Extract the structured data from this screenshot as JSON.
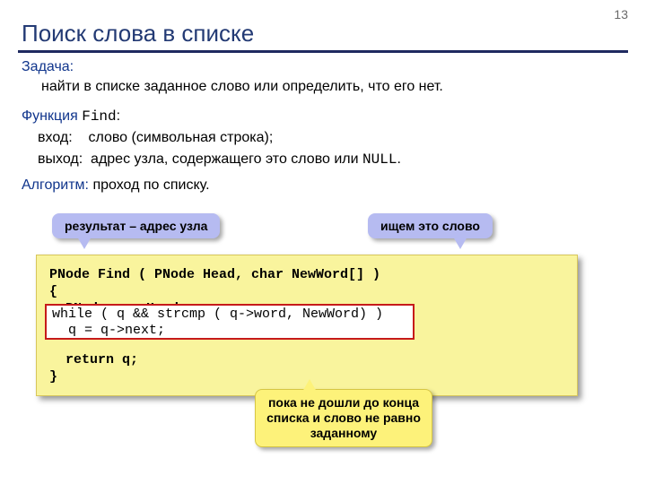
{
  "page_number": "13",
  "title": "Поиск слова в списке",
  "task": {
    "label": "Задача:",
    "text": "найти в списке заданное слово или определить, что его нет."
  },
  "func": {
    "label": "Функция",
    "name": "Find",
    "colon": ":",
    "in_label": "вход:",
    "in_text": "слово (символьная строка);",
    "out_label": "выход:",
    "out_text1": "адрес узла, содержащего это слово или",
    "out_null": "NULL",
    "out_dot": "."
  },
  "algo": {
    "label": "Алгоритм:",
    "text": "проход по списку."
  },
  "callouts": {
    "result": "результат – адрес узла",
    "search": "ищем это слово",
    "loop": "пока не дошли до конца списка и слово не равно заданному"
  },
  "code": {
    "line1": "PNode Find ( PNode Head, char NewWord[] )",
    "line2": "{",
    "line3": "  PNode q = Head;",
    "line4": "  while ( q && strcmp ( q->word, NewWord) )",
    "line5": "    q = q->next;",
    "line6": "  return q;",
    "line7": "}",
    "while1": "while ( q && strcmp ( q->word, NewWord) )",
    "while2": "  q = q->next;"
  }
}
